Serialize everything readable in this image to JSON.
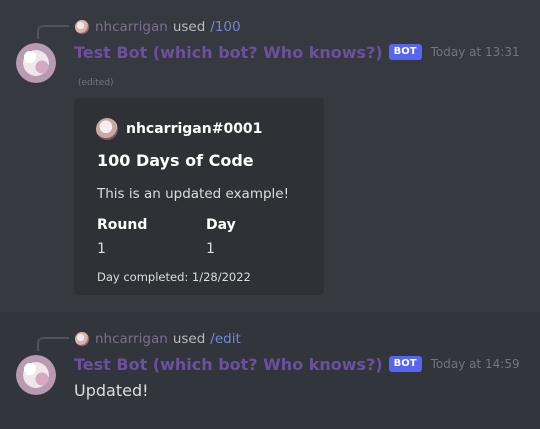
{
  "messages": [
    {
      "interaction": {
        "user": "nhcarrigan",
        "used": "used",
        "command": "/100"
      },
      "author": "Test Bot (which bot? Who knows?)",
      "badge": "BOT",
      "timestamp": "Today at 13:31",
      "edited": "(edited)",
      "embed": {
        "author": "nhcarrigan#0001",
        "title": "100 Days of Code",
        "description": "This is an updated example!",
        "fields": [
          {
            "name": "Round",
            "value": "1"
          },
          {
            "name": "Day",
            "value": "1"
          }
        ],
        "footer": "Day completed: 1/28/2022"
      }
    },
    {
      "interaction": {
        "user": "nhcarrigan",
        "used": "used",
        "command": "/edit"
      },
      "author": "Test Bot (which bot? Who knows?)",
      "badge": "BOT",
      "timestamp": "Today at 14:59",
      "content": "Updated!"
    }
  ],
  "colors": {
    "background": "#36393f",
    "embed_background": "#2f3136",
    "bot_name": "#6c4f9e",
    "badge": "#5865f2",
    "command": "#7289da"
  }
}
